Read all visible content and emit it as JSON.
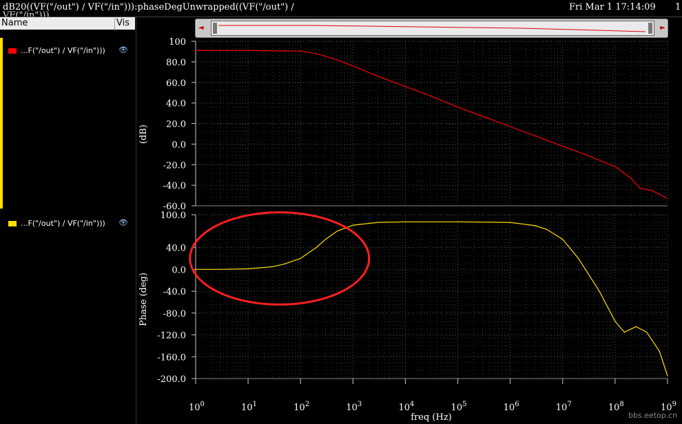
{
  "window": {
    "title_line1": "dB20((VF(\"/out\") / VF(\"/in\"))):phaseDegUnwrapped((VF(\"/out\") /",
    "title_line2": "VF(\"/in\")))",
    "timestamp": "Fri Mar 1 17:14:09",
    "page_number": "1",
    "watermark": "bbs.eetop.cn"
  },
  "legend": {
    "header_name": "Name",
    "header_vis": "Vis",
    "items": [
      {
        "label": "...F(\"/out\") / VF(\"/in\")))",
        "color": "#ff0000",
        "visibility_icon": "eye-icon"
      },
      {
        "label": "...F(\"/out\") / VF(\"/in\")))",
        "color": "#ffe000",
        "visibility_icon": "eye-icon"
      }
    ]
  },
  "scrollbar": {
    "left_arrow": "◄",
    "right_arrow": "►"
  },
  "chart_data": [
    {
      "type": "line",
      "title": "",
      "xlabel": "freq (Hz)",
      "ylabel": "(dB)",
      "xscale": "log",
      "xlim": [
        1,
        1000000000
      ],
      "ylim": [
        -60,
        100
      ],
      "grid": true,
      "yticks": [
        "100",
        "80.0",
        "60.0",
        "40.0",
        "20.0",
        "0.0",
        "-20.0",
        "-40.0",
        "-60.0"
      ],
      "series": [
        {
          "color": "#ff0000",
          "x": [
            1,
            10,
            100,
            200,
            500,
            1000,
            3000,
            10000,
            30000,
            100000,
            300000,
            1000000,
            3000000,
            10000000,
            30000000,
            100000000,
            200000000,
            300000000,
            500000000,
            1000000000
          ],
          "y": [
            91,
            91,
            90.5,
            88,
            82,
            76,
            66,
            56,
            47,
            36,
            27,
            17,
            8,
            -2,
            -11,
            -22,
            -33,
            -43,
            -45,
            -53
          ]
        }
      ]
    },
    {
      "type": "line",
      "title": "",
      "xlabel": "freq (Hz)",
      "ylabel": "Phase (deg)",
      "xscale": "log",
      "xlim": [
        1,
        1000000000
      ],
      "ylim": [
        -200,
        100
      ],
      "grid": true,
      "yticks": [
        "100.0",
        "40.0",
        "0.0",
        "-40.0",
        "-80.0",
        "-120.0",
        "-160.0",
        "-200.0"
      ],
      "series": [
        {
          "color": "#ffe000",
          "x": [
            1,
            3,
            10,
            30,
            50,
            100,
            200,
            300,
            500,
            1000,
            3000,
            10000,
            100000,
            1000000,
            3000000,
            5000000,
            10000000,
            20000000,
            50000000,
            100000000,
            150000000,
            250000000,
            400000000,
            700000000,
            1000000000
          ],
          "y": [
            0,
            0,
            1,
            5,
            10,
            20,
            40,
            55,
            70,
            81,
            86,
            87,
            87,
            86,
            80,
            73,
            55,
            20,
            -40,
            -95,
            -115,
            -105,
            -115,
            -150,
            -195
          ]
        }
      ],
      "annotations": [
        {
          "type": "ellipse",
          "color": "#ff2020"
        }
      ]
    }
  ],
  "x_tick_labels": [
    {
      "base": "10",
      "exp": "0"
    },
    {
      "base": "10",
      "exp": "1"
    },
    {
      "base": "10",
      "exp": "2"
    },
    {
      "base": "10",
      "exp": "3"
    },
    {
      "base": "10",
      "exp": "4"
    },
    {
      "base": "10",
      "exp": "5"
    },
    {
      "base": "10",
      "exp": "6"
    },
    {
      "base": "10",
      "exp": "7"
    },
    {
      "base": "10",
      "exp": "8"
    },
    {
      "base": "10",
      "exp": "9"
    }
  ]
}
